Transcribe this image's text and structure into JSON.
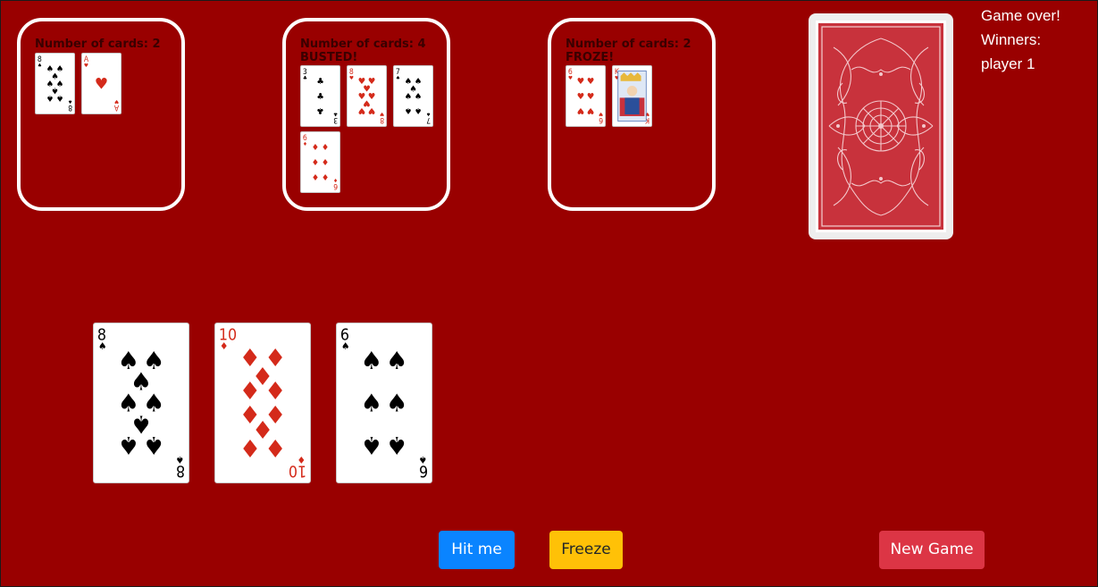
{
  "players": [
    {
      "count_text": "Number of cards: 2",
      "status": "",
      "cards": [
        {
          "rank": "8",
          "suit": "spades"
        },
        {
          "rank": "A",
          "suit": "hearts"
        }
      ]
    },
    {
      "count_text": "Number of cards: 4",
      "status": "BUSTED!",
      "cards": [
        {
          "rank": "3",
          "suit": "clubs"
        },
        {
          "rank": "8",
          "suit": "hearts"
        },
        {
          "rank": "7",
          "suit": "spades"
        },
        {
          "rank": "6",
          "suit": "diamonds"
        }
      ]
    },
    {
      "count_text": "Number of cards: 2",
      "status": "FROZE!",
      "cards": [
        {
          "rank": "6",
          "suit": "hearts"
        },
        {
          "rank": "K",
          "suit": "hearts"
        }
      ]
    }
  ],
  "deck": {
    "label": "card-back",
    "color": "#c8323c"
  },
  "game_status": {
    "line1": "Game over!",
    "line2": "Winners:",
    "line3": "player 1"
  },
  "hand": [
    {
      "rank": "8",
      "suit": "spades"
    },
    {
      "rank": "10",
      "suit": "diamonds"
    },
    {
      "rank": "6",
      "suit": "spades"
    }
  ],
  "buttons": {
    "hit_label": "Hit me",
    "freeze_label": "Freeze",
    "new_game_label": "New Game"
  },
  "colors": {
    "table": "#990000",
    "hit": "#0a84ff",
    "freeze": "#ffc107",
    "new_game": "#dc3545",
    "red_suit": "#d42a1a",
    "black_suit": "#000000"
  }
}
